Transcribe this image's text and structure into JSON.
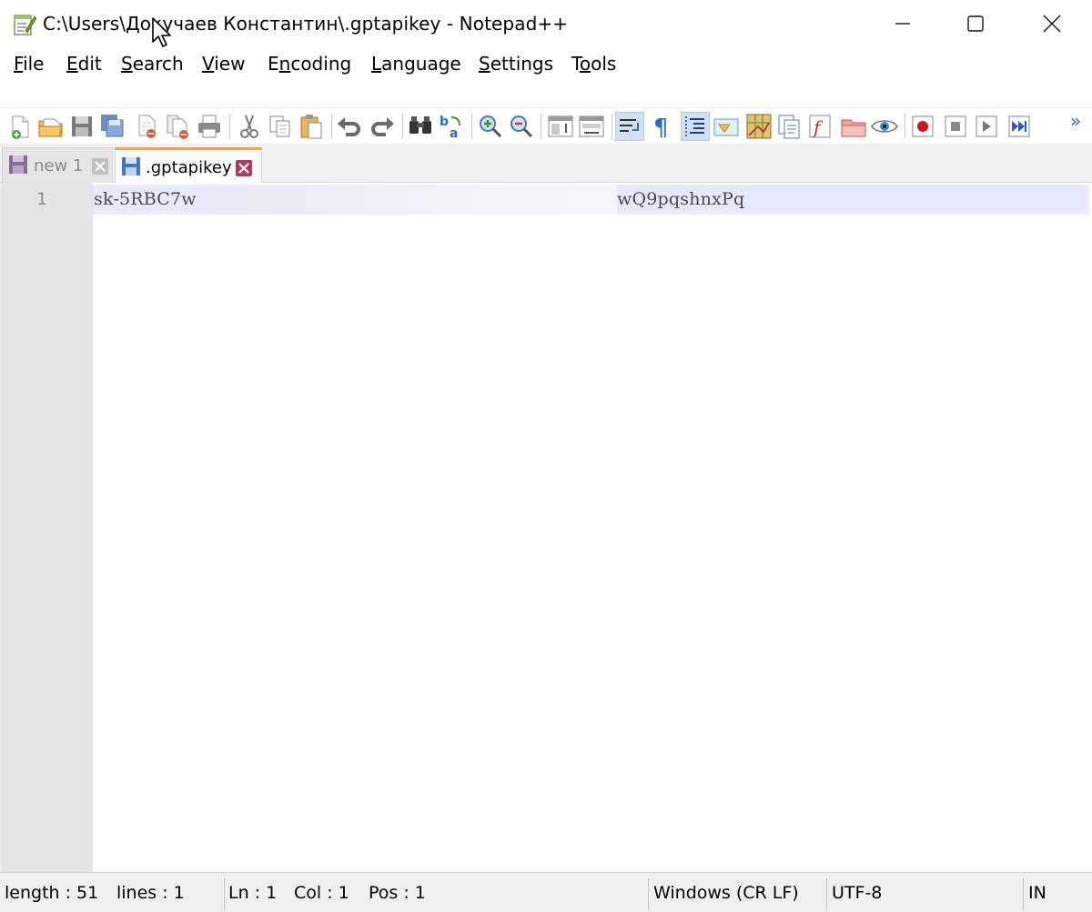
{
  "window": {
    "title": "C:\\Users\\Докучаев Константин\\.gptapikey - Notepad++"
  },
  "menu": {
    "items": [
      {
        "label": "File",
        "accel": "F",
        "rest": "ile"
      },
      {
        "label": "Edit",
        "accel": "E",
        "rest": "dit"
      },
      {
        "label": "Search",
        "accel": "S",
        "rest": "earch"
      },
      {
        "label": "View",
        "accel": "V",
        "rest": "iew"
      },
      {
        "label": "Encoding",
        "pre": "E",
        "accel": "n",
        "rest": "coding"
      },
      {
        "label": "Language",
        "accel": "L",
        "rest": "anguage"
      },
      {
        "label": "Settings",
        "accel": "S",
        "rest": "ettings"
      },
      {
        "label": "Tools",
        "pre": "T",
        "accel": "o",
        "rest": "ols"
      }
    ]
  },
  "toolbar": {
    "icons": [
      "new-file-icon",
      "open-file-icon",
      "save-icon",
      "save-all-icon",
      "close-icon",
      "close-all-icon",
      "print-icon",
      "cut-icon",
      "copy-icon",
      "paste-icon",
      "undo-icon",
      "redo-icon",
      "find-icon",
      "replace-icon",
      "zoom-in-icon",
      "zoom-out-icon",
      "sync-vertical-icon",
      "sync-horizontal-icon",
      "word-wrap-icon",
      "show-all-chars-icon",
      "indent-guide-icon",
      "user-language-icon",
      "document-map-icon",
      "document-list-icon",
      "function-list-icon",
      "folder-workspace-icon",
      "monitoring-icon",
      "record-macro-icon",
      "stop-macro-icon",
      "play-macro-icon",
      "run-macro-multiple-icon"
    ],
    "more": "»"
  },
  "tabs": [
    {
      "label": "new 1",
      "active": false
    },
    {
      "label": ".gptapikey",
      "active": true
    }
  ],
  "editor": {
    "line_number": "1",
    "text_start": "sk-5RBC7w",
    "text_end": "wQ9pqshnxPq"
  },
  "status": {
    "length": "length : 51",
    "lines": "lines : 1",
    "ln": "Ln : 1",
    "col": "Col : 1",
    "pos": "Pos : 1",
    "eol": "Windows (CR LF)",
    "encoding": "UTF-8",
    "mode": "IN"
  },
  "colors": {
    "accent_tab": "#f5a34a",
    "current_line": "#e8e8ff",
    "gutter": "#e4e4e4"
  }
}
